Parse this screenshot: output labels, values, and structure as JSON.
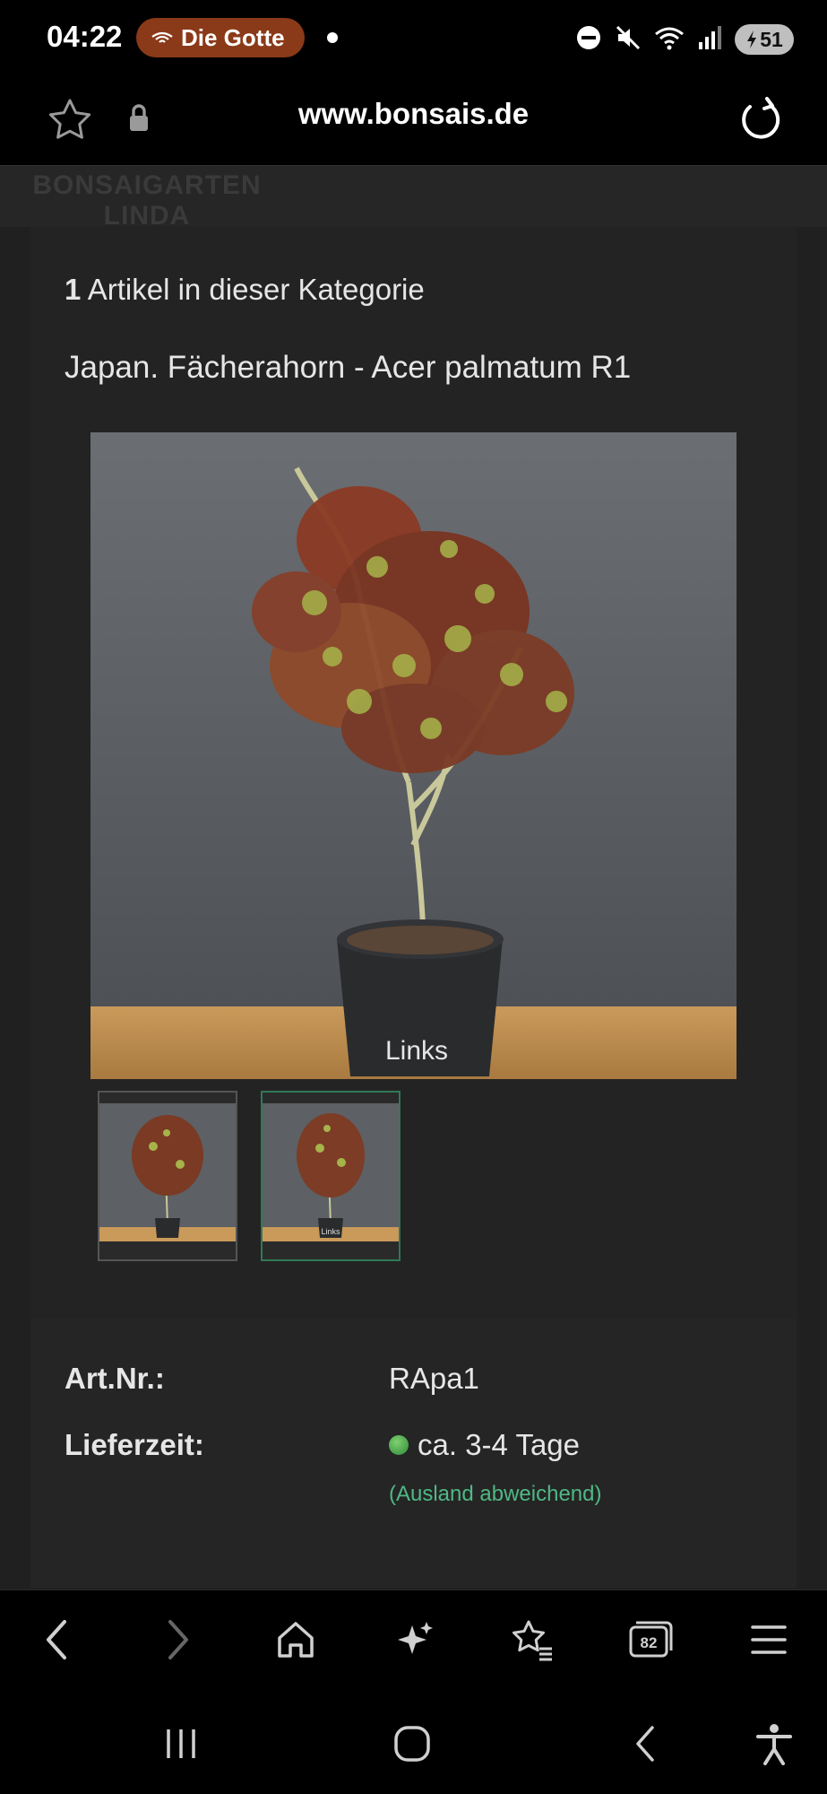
{
  "status_bar": {
    "time": "04:22",
    "media_title": "Die Gotte",
    "battery": "51"
  },
  "browser": {
    "url": "www.bonsais.de",
    "tab_count": "82"
  },
  "site": {
    "logo_line1": "BONSAIGARTEN",
    "logo_line2": "LINDA"
  },
  "category": {
    "count": "1",
    "count_text": "Artikel in dieser Kategorie"
  },
  "product": {
    "title": "Japan. Fächerahorn - Acer palmatum R1",
    "image_caption": "Links",
    "thumb_caption": "Links",
    "article_number_label": "Art.Nr.:",
    "article_number": "RApa1",
    "delivery_label": "Lieferzeit:",
    "delivery_time": "ca. 3-4 Tage",
    "delivery_note": "(Ausland abweichend)"
  },
  "icons": {
    "status": [
      "dnd-icon",
      "mute-icon",
      "wifi-icon",
      "signal-icon",
      "battery-icon"
    ],
    "toolbar": [
      "back-icon",
      "forward-icon",
      "home-icon",
      "sparkle-icon",
      "bookmarks-icon",
      "tabs-icon",
      "menu-icon"
    ],
    "system_nav": [
      "recents-icon",
      "home-circle-icon",
      "system-back-icon",
      "accessibility-icon"
    ]
  },
  "colors": {
    "background": "#202020",
    "media_pill": "#8a3a18",
    "accent_green": "#4fb884",
    "selected_thumb_border": "#2f7a55"
  }
}
